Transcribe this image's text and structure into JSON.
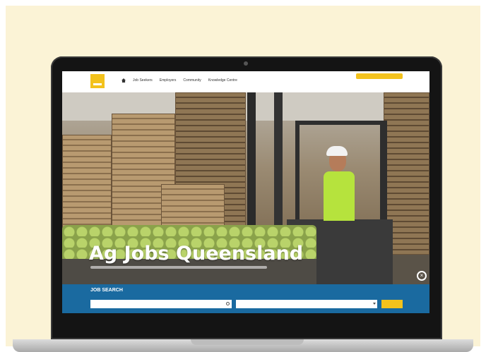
{
  "header": {
    "nav": [
      "Job Seekers",
      "Employers",
      "Community",
      "Knowledge Centre"
    ],
    "cta_label": "",
    "link_label": ""
  },
  "hero": {
    "title": "Ag Jobs Queensland"
  },
  "job_search": {
    "title": "JOB SEARCH",
    "advanced_label": "",
    "keyword_placeholder": "",
    "location_placeholder": "",
    "search_button": ""
  },
  "colors": {
    "brand_yellow": "#f3c21c",
    "search_blue": "#1a6aa0",
    "poster_bg": "#fbf3d6"
  },
  "icons": [
    "home-icon",
    "search-icon",
    "chevron-down-icon",
    "close-icon"
  ]
}
